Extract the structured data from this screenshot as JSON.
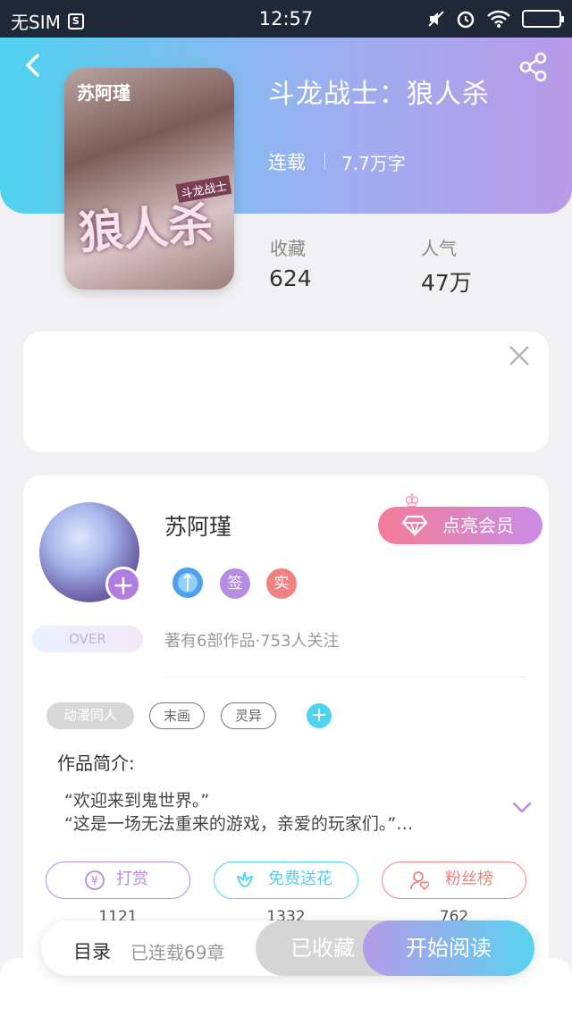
{
  "status_bar": {
    "carrier": "无SIM",
    "time": "12:57"
  },
  "book": {
    "title": "斗龙战士：狼人杀",
    "status": "连载",
    "word_count": "7.7万字",
    "cover": {
      "author_text": "苏阿瑾",
      "series_text": "斗龙战士",
      "title_text": "狼人杀"
    },
    "stats": [
      {
        "label": "收藏",
        "value": "624"
      },
      {
        "label": "人气",
        "value": "47万"
      }
    ]
  },
  "author": {
    "name": "苏阿瑾",
    "vip_button": "点亮会员",
    "badges": [
      "签",
      "实"
    ],
    "level_badge": "OVER",
    "meta": "著有6部作品·753人关注"
  },
  "tags": [
    "动漫同人",
    "末画",
    "灵异"
  ],
  "intro": {
    "heading": "作品简介:",
    "lines": [
      "“欢迎来到鬼世界。”",
      "“这是一场无法重来的游戏，亲爱的玩家们。”…"
    ]
  },
  "actions": [
    {
      "label": "打赏",
      "count": "1121",
      "color": "#b68de0"
    },
    {
      "label": "免费送花",
      "count": "1332",
      "color": "#4fd3ee"
    },
    {
      "label": "粉丝榜",
      "count": "762",
      "color": "#f28181"
    }
  ],
  "bottom_bar": {
    "toc": "目录",
    "chapters": "已连载69章",
    "collected": "已收藏",
    "read": "开始阅读"
  }
}
